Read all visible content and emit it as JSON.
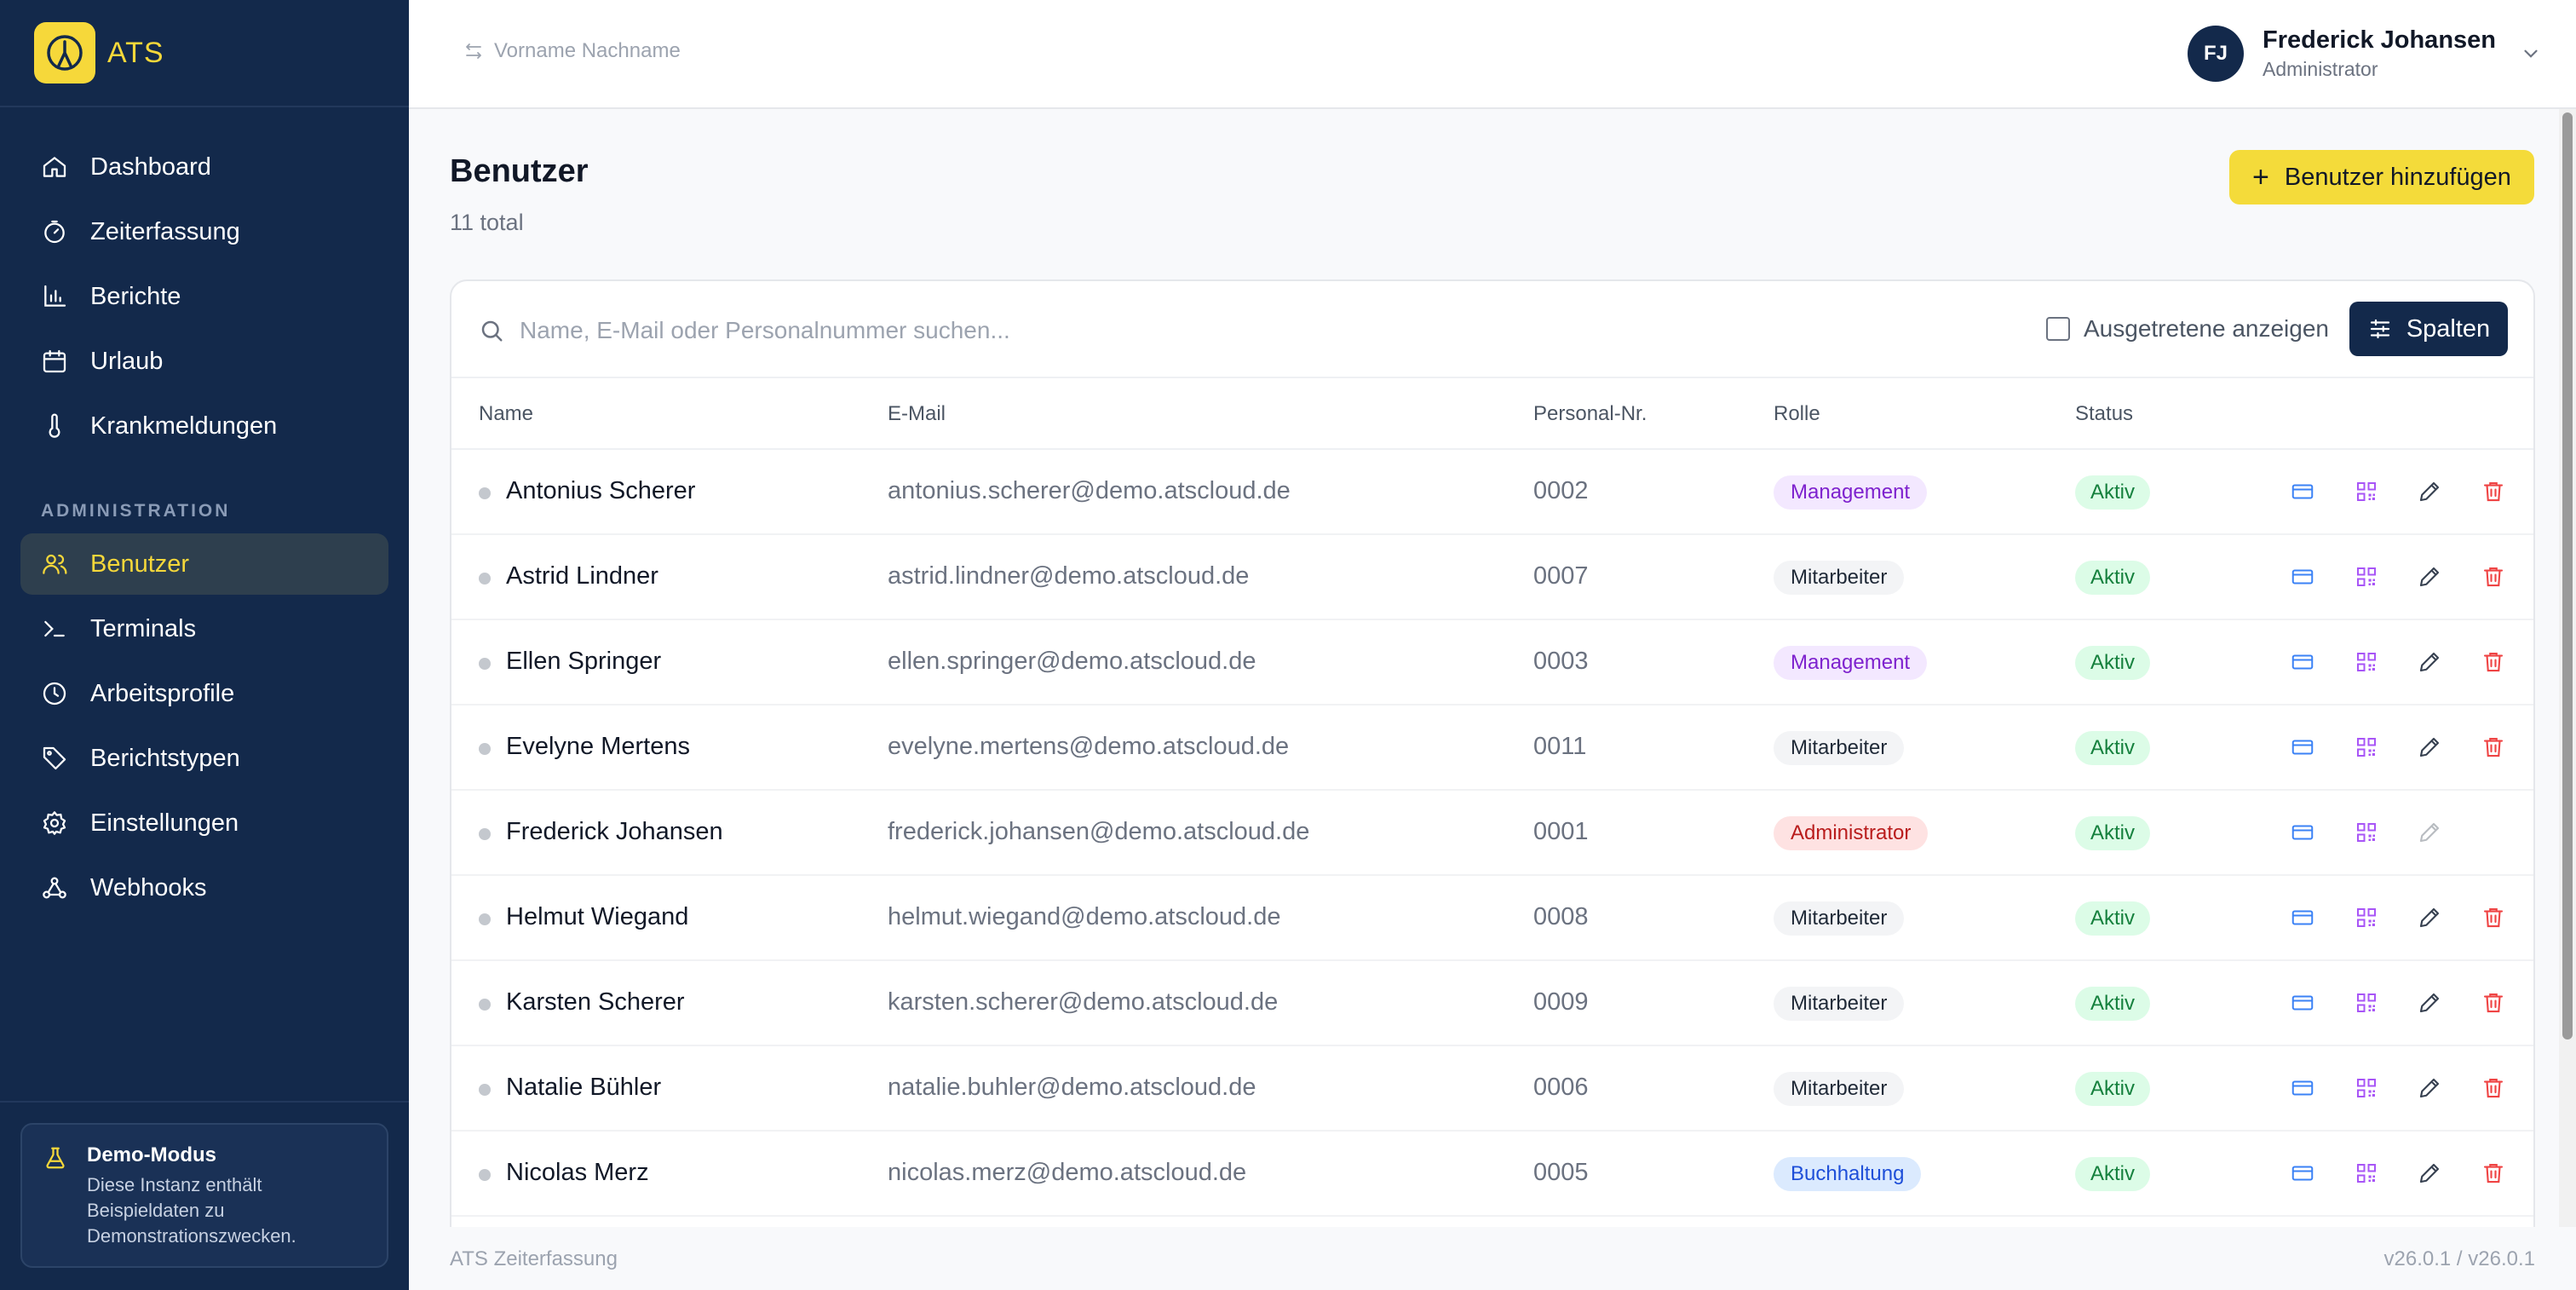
{
  "app": {
    "name": "ATS"
  },
  "sidebar": {
    "items": [
      {
        "label": "Dashboard",
        "icon": "home-icon"
      },
      {
        "label": "Zeiterfassung",
        "icon": "stopwatch-icon"
      },
      {
        "label": "Berichte",
        "icon": "bar-chart-icon"
      },
      {
        "label": "Urlaub",
        "icon": "calendar-icon"
      },
      {
        "label": "Krankmeldungen",
        "icon": "thermometer-icon"
      }
    ],
    "section_label": "ADMINISTRATION",
    "admin_items": [
      {
        "label": "Benutzer",
        "icon": "users-icon",
        "active": true
      },
      {
        "label": "Terminals",
        "icon": "terminal-icon"
      },
      {
        "label": "Arbeitsprofile",
        "icon": "clock-icon"
      },
      {
        "label": "Berichtstypen",
        "icon": "tag-icon"
      },
      {
        "label": "Einstellungen",
        "icon": "gear-icon"
      },
      {
        "label": "Webhooks",
        "icon": "webhook-icon"
      }
    ],
    "demo": {
      "title": "Demo-Modus",
      "description": "Diese Instanz enthält Beispieldaten zu Demonstrationszwecken."
    }
  },
  "header": {
    "switcher_label": "Vorname Nachname",
    "user": {
      "initials": "FJ",
      "name": "Frederick Johansen",
      "role": "Administrator"
    }
  },
  "page": {
    "title": "Benutzer",
    "subtitle": "11 total",
    "add_button": "Benutzer hinzufügen"
  },
  "toolbar": {
    "search_placeholder": "Name, E-Mail oder Personalnummer suchen...",
    "show_inactive_label": "Ausgetretene anzeigen",
    "show_inactive_checked": false,
    "columns_button": "Spalten"
  },
  "table": {
    "columns": [
      "Name",
      "E-Mail",
      "Personal-Nr.",
      "Rolle",
      "Status"
    ],
    "rows": [
      {
        "name": "Antonius Scherer",
        "email": "antonius.scherer@demo.atscloud.de",
        "pnr": "0002",
        "role": "Management",
        "status": "Aktiv"
      },
      {
        "name": "Astrid Lindner",
        "email": "astrid.lindner@demo.atscloud.de",
        "pnr": "0007",
        "role": "Mitarbeiter",
        "status": "Aktiv"
      },
      {
        "name": "Ellen Springer",
        "email": "ellen.springer@demo.atscloud.de",
        "pnr": "0003",
        "role": "Management",
        "status": "Aktiv"
      },
      {
        "name": "Evelyne Mertens",
        "email": "evelyne.mertens@demo.atscloud.de",
        "pnr": "0011",
        "role": "Mitarbeiter",
        "status": "Aktiv"
      },
      {
        "name": "Frederick Johansen",
        "email": "frederick.johansen@demo.atscloud.de",
        "pnr": "0001",
        "role": "Administrator",
        "status": "Aktiv"
      },
      {
        "name": "Helmut Wiegand",
        "email": "helmut.wiegand@demo.atscloud.de",
        "pnr": "0008",
        "role": "Mitarbeiter",
        "status": "Aktiv"
      },
      {
        "name": "Karsten Scherer",
        "email": "karsten.scherer@demo.atscloud.de",
        "pnr": "0009",
        "role": "Mitarbeiter",
        "status": "Aktiv"
      },
      {
        "name": "Natalie Bühler",
        "email": "natalie.buhler@demo.atscloud.de",
        "pnr": "0006",
        "role": "Mitarbeiter",
        "status": "Aktiv"
      },
      {
        "name": "Nicolas Merz",
        "email": "nicolas.merz@demo.atscloud.de",
        "pnr": "0005",
        "role": "Buchhaltung",
        "status": "Aktiv"
      }
    ],
    "row_actions": [
      "card-icon",
      "qr-code-icon",
      "pencil-icon",
      "trash-icon"
    ]
  },
  "footer": {
    "left": "ATS Zeiterfassung",
    "right": "v26.0.1 / v26.0.1"
  },
  "colors": {
    "sidebar_bg": "#13294b",
    "accent_yellow": "#f4db3a",
    "active_item_bg": "#2e3f4e"
  }
}
